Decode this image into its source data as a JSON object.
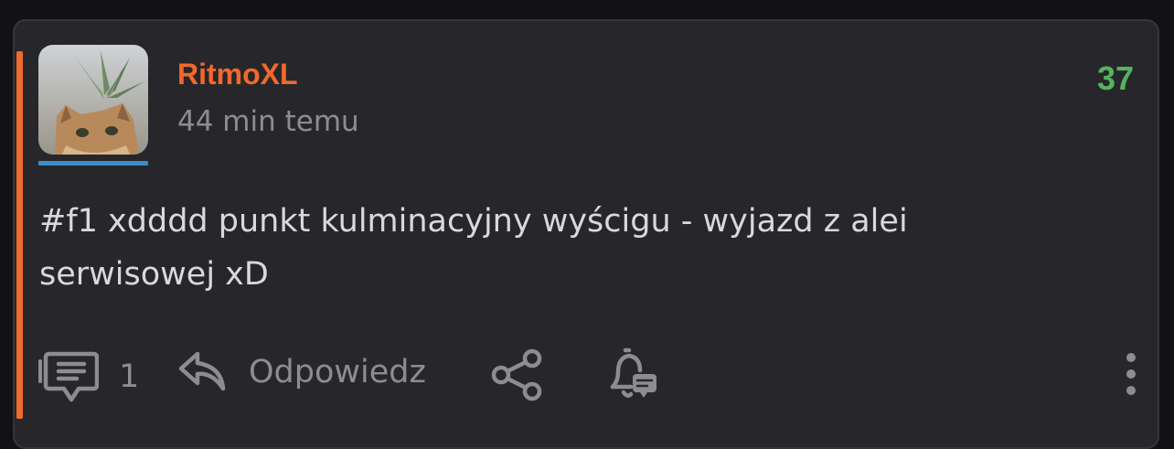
{
  "post": {
    "author": "RitmoXL",
    "time_ago": "44 min temu",
    "score": "37",
    "content_line1": "#f1 xdddd punkt kulminacyjny wyścigu - wyjazd z alei",
    "content_line2": "serwisowej xD"
  },
  "actions": {
    "comments_count": "1",
    "reply_label": "Odpowiedz"
  },
  "colors": {
    "accent": "#f06a2b",
    "author": "#f2682d",
    "score": "#54b35e",
    "avatar_underline": "#3b8fc9"
  },
  "icons": [
    "comment-icon",
    "reply-icon",
    "share-icon",
    "notification-bell-icon",
    "more-options-icon"
  ]
}
